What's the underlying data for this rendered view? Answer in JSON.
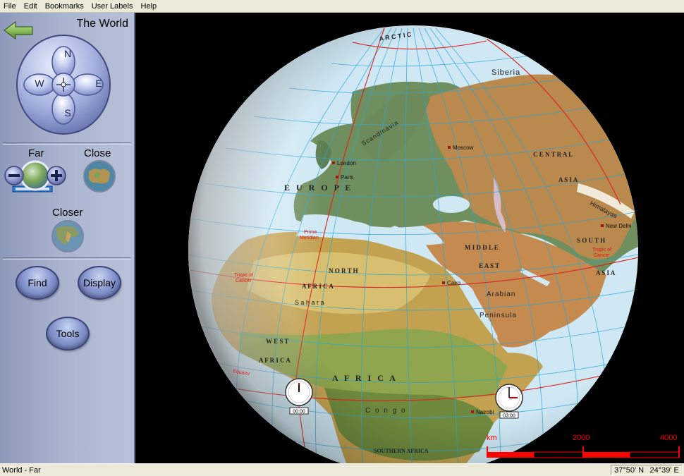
{
  "menu": [
    "File",
    "Edit",
    "Bookmarks",
    "User Labels",
    "Help"
  ],
  "sidebar": {
    "title": "The World",
    "compass": {
      "n": "N",
      "s": "S",
      "e": "E",
      "w": "W"
    },
    "zoom": {
      "far": "Far",
      "close": "Close",
      "closer": "Closer"
    },
    "buttons": {
      "find": "Find",
      "display": "Display",
      "tools": "Tools"
    }
  },
  "map": {
    "region_labels": {
      "arctic": "A R C T I C",
      "siberia": "Siberia",
      "scandinavia": "Scandinavia",
      "europe": "E U R O P E",
      "central": "C E N T R A L",
      "asia": "A S I A",
      "himalayas": "Himalayas",
      "south": "S O U T H",
      "asia2": "A S I A",
      "middle": "M I D D L E",
      "east": "E A S T",
      "arabian": "Arabian",
      "peninsula": "Peninsula",
      "north": "N O R T H",
      "africa_n": "A F R I C A",
      "sahara": "S a h a r a",
      "west": "W E S T",
      "africa_w": "A F R I C A",
      "africa": "A F R I C A",
      "congo": "C o n g o",
      "southern_africa": "SOUTHERN AFRICA"
    },
    "cities": {
      "moscow": "Moscow",
      "london": "London",
      "paris": "Paris",
      "new_delhi": "New Delhi",
      "cairo": "Cairo",
      "nairobi": "Nairobi"
    },
    "red_labels": {
      "prime_meridian_1": "Prime",
      "prime_meridian_2": "Meridian",
      "tropic_left_1": "Tropic of",
      "tropic_left_2": "Cancer",
      "tropic_right_1": "Tropic of",
      "tropic_right_2": "Cancer",
      "equator": "Equator"
    },
    "clocks": {
      "left": "00:00",
      "right": "03:00"
    }
  },
  "scale": {
    "unit": "km",
    "mid": "2000",
    "max": "4000",
    "color": "#ff0000"
  },
  "status": {
    "view": "World - Far",
    "lat": "37°50' N",
    "lon": "24°39' E"
  },
  "colors": {
    "sidebar": "#aab4cf",
    "pill": "#8b9bd1",
    "ocean": "#cfe8f4",
    "grid": "#2aa7d8"
  }
}
